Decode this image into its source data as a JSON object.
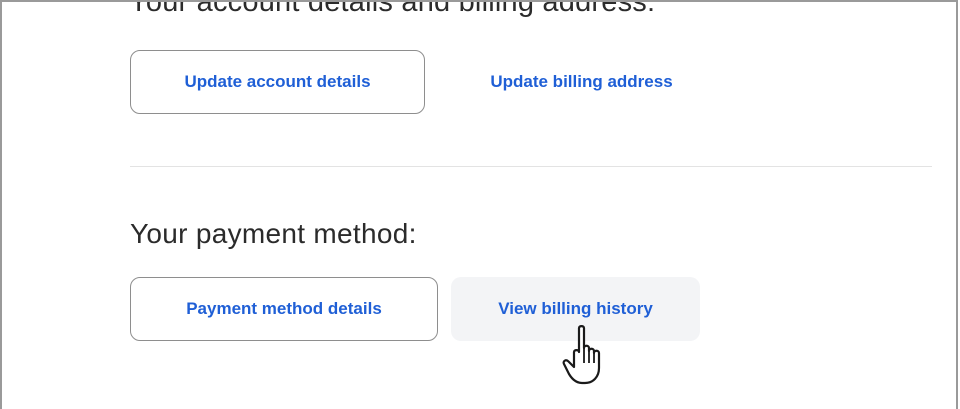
{
  "account": {
    "heading": "Your account details and billing address:",
    "update_account_label": "Update account details",
    "update_billing_label": "Update billing address"
  },
  "payment": {
    "heading": "Your payment method:",
    "payment_details_label": "Payment method details",
    "view_history_label": "View billing history"
  },
  "cursor": {
    "icon": "hand-pointer-icon"
  },
  "colors": {
    "link": "#1f5fd6",
    "text": "#2b2b2b",
    "border": "#8e8e8e",
    "hover_bg": "#f3f4f6"
  }
}
